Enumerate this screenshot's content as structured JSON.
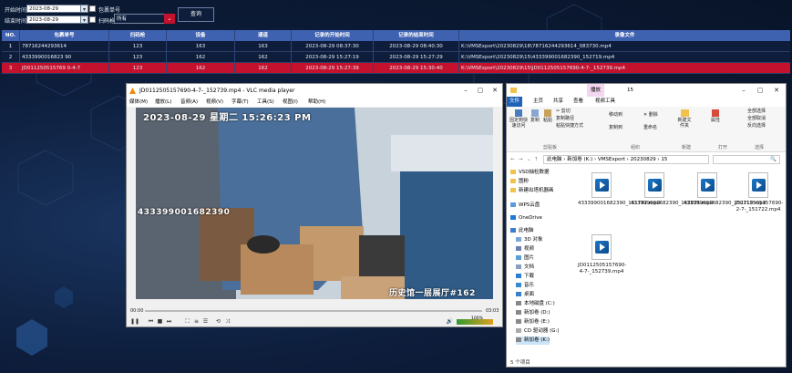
{
  "filters": {
    "start_label": "开始时间",
    "start_value": "2023-08-29 00:00:00",
    "end_label": "结束时间",
    "end_value": "2023-08-29 23:59:59",
    "package_label": "包裹单号",
    "scan_label": "扫码枪",
    "scan_value": "所有",
    "query_label": "查询"
  },
  "table": {
    "headers": [
      "NO.",
      "包裹单号",
      "扫码枪",
      "设备",
      "通道",
      "记录的开始时间",
      "记录的结束时间",
      "录像文件"
    ],
    "rows": [
      [
        "1",
        "78716244293614",
        "123",
        "163",
        "163",
        "2023-08-29 08:37:30",
        "2023-08-29 08:40:30",
        "K:\\VMSExport\\20230829\\18\\78716244293614_083730.mp4"
      ],
      [
        "2",
        "4333990016823 90",
        "123",
        "162",
        "162",
        "2023-08-29 15:27:19",
        "2023-08-29 15:27:29",
        "K:\\VMSExport\\20230829\\15\\433399001682390_152719.mp4"
      ],
      [
        "3",
        "JD011250515769 0-4-7",
        "123",
        "162",
        "162",
        "2023-08-29 15:27:39",
        "2023-08-29 15:30:40",
        "K:\\VMSExport\\20230829\\15\\JD0112505157690-4-7-_152739.mp4"
      ]
    ]
  },
  "vlc": {
    "title": "JD0112505157690-4-7-_152739.mp4 - VLC media player",
    "menu": [
      "媒体(M)",
      "播放(L)",
      "音频(A)",
      "视频(V)",
      "字幕(T)",
      "工具(S)",
      "视图(I)",
      "帮助(H)"
    ],
    "osd_time": "2023-08-29 星期二 15:26:23 PM",
    "osd_code": "433399001682390",
    "osd_caption": "历史馆一层展厅#162",
    "time_current": "00:00",
    "time_total": "03:03",
    "volume": "100%"
  },
  "explorer": {
    "title": "15",
    "tab_play": "播放",
    "tabs": [
      "文件",
      "主页",
      "共享",
      "查看",
      "视频工具"
    ],
    "ribbon": {
      "pin": "固定到快速访问",
      "copy": "复制",
      "paste": "粘贴",
      "cut": "剪切",
      "copy_path": "复制路径",
      "paste_shortcut": "粘贴快捷方式",
      "move_to": "移动到",
      "copy_to": "复制到",
      "delete": "删除",
      "rename": "重命名",
      "new_folder": "新建文件夹",
      "properties": "属性",
      "select_all": "全部选择",
      "select_none": "全部取消",
      "invert": "反向选择",
      "groups": [
        "剪贴板",
        "组织",
        "新建",
        "打开",
        "选择"
      ]
    },
    "path": [
      "此电脑",
      "新加卷 (K:)",
      "VMSExport",
      "20230829",
      "15"
    ],
    "search": "🔍",
    "nav": [
      "VSD抽检数据",
      "图粉",
      "新建出塔机器画",
      "WPS云盘",
      "OneDrive",
      "此电脑",
      "3D 对象",
      "视频",
      "图片",
      "文档",
      "下载",
      "音乐",
      "桌面",
      "本地磁盘 (C:)",
      "新加卷 (D:)",
      "新加卷 (E:)",
      "CD 驱动器 (G:)",
      "新加卷 (K:)"
    ],
    "files": [
      "433399001682390_151742.mp4",
      "433399001682390_152025.mp4",
      "433399001682390_152719.mp4",
      "JD0112505157690-2-7-_151722.mp4",
      "JD0112505157690-4-7-_152739.mp4"
    ],
    "status": "5 个项目"
  },
  "colors": {
    "header_blue": "#3e61b0",
    "selected_red": "#c4122e",
    "page_bg": "#0d1d3b"
  }
}
